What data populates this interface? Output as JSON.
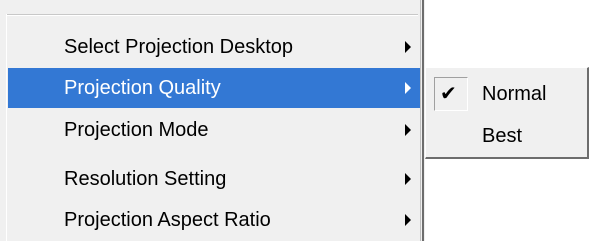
{
  "menu": {
    "items": [
      {
        "label": "Select Projection Desktop",
        "has_submenu": true,
        "selected": false
      },
      {
        "label": "Projection Quality",
        "has_submenu": true,
        "selected": true
      },
      {
        "label": "Projection Mode",
        "has_submenu": true,
        "selected": false
      },
      {
        "label": "Resolution Setting",
        "has_submenu": true,
        "selected": false
      },
      {
        "label": "Projection Aspect Ratio",
        "has_submenu": true,
        "selected": false
      }
    ]
  },
  "submenu": {
    "items": [
      {
        "label": "Normal",
        "checked": true,
        "check_glyph": "✔"
      },
      {
        "label": "Best",
        "checked": false
      }
    ]
  },
  "colors": {
    "highlight": "#3378d4",
    "menu_background": "#f0f0f0",
    "text": "#000000",
    "highlight_text": "#ffffff"
  },
  "icons": {
    "submenu_arrow": "submenu-arrow-icon",
    "check": "checkmark-icon"
  }
}
